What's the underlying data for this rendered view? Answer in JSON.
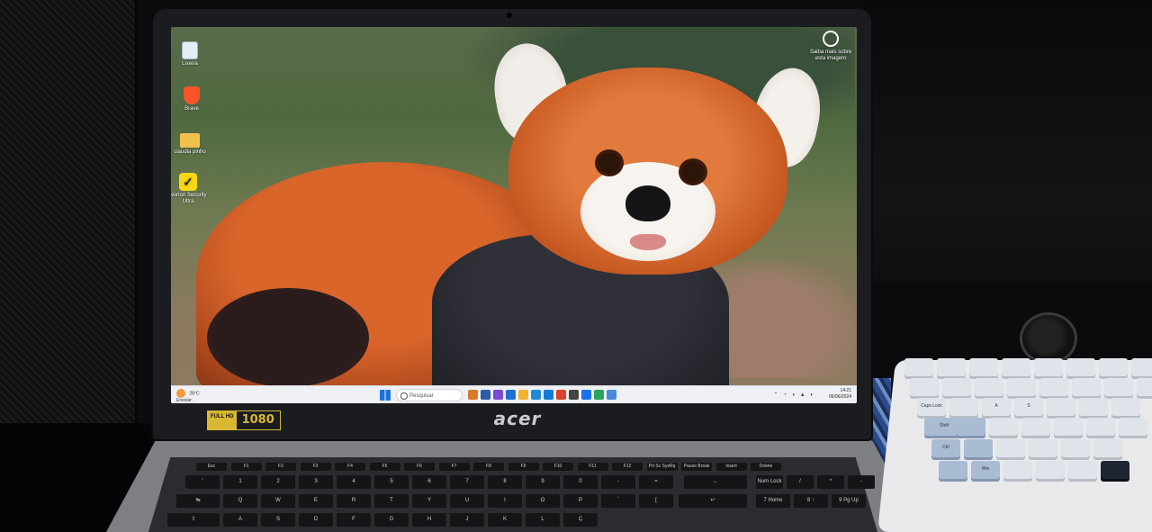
{
  "screen": {
    "desktop_icons": [
      {
        "label": "Lixeira",
        "icon": "recycle-bin-icon"
      },
      {
        "label": "Brave",
        "icon": "brave-lion-icon"
      },
      {
        "label": "claudia pinho",
        "icon": "folder-icon"
      },
      {
        "label": "Norton Security Ultra",
        "icon": "norton-check-icon"
      }
    ],
    "spotlight": {
      "label": "Saiba mais sobre esta imagem",
      "icon": "camera-spotlight-icon"
    },
    "taskbar": {
      "weather": {
        "temp": "28°C",
        "condition": "Ensolar.",
        "icon": "sun-icon"
      },
      "search_placeholder": "Pesquisar",
      "start_icon": "windows-start-icon",
      "pinned_apps": [
        {
          "name": "app-icon-1",
          "color": "#d97a2a"
        },
        {
          "name": "app-icon-2",
          "color": "#2e5aa8"
        },
        {
          "name": "app-icon-3",
          "color": "#7a4ad0"
        },
        {
          "name": "app-icon-4",
          "color": "#1f6fd1"
        },
        {
          "name": "app-icon-5",
          "color": "#f2b233"
        },
        {
          "name": "app-icon-6",
          "color": "#1d8ad8"
        },
        {
          "name": "app-icon-7",
          "color": "#0e7bd6"
        },
        {
          "name": "app-icon-8",
          "color": "#d8432a"
        },
        {
          "name": "app-icon-9",
          "color": "#444444"
        },
        {
          "name": "app-icon-10",
          "color": "#1a73e8"
        },
        {
          "name": "app-icon-11",
          "color": "#2aa55a"
        },
        {
          "name": "app-icon-12",
          "color": "#4a8ad8"
        }
      ],
      "tray_time": "14:21",
      "tray_date": "06/06/2024"
    }
  },
  "bezel": {
    "badge_left": "FULL HD",
    "badge_right": "1080",
    "brand": "acer"
  },
  "keyboard": {
    "function_row": [
      "Esc",
      "F1",
      "F2",
      "F3",
      "F4",
      "F5",
      "F6",
      "F7",
      "F8",
      "F9",
      "F10",
      "F11",
      "F12",
      "Prt Sc SysRq",
      "Pause Break",
      "Insert",
      "Delete"
    ],
    "number_row": [
      "'",
      "1",
      "2",
      "3",
      "4",
      "5",
      "6",
      "7",
      "8",
      "9",
      "0",
      "-",
      "="
    ],
    "qwerty_row": [
      "Q",
      "W",
      "E",
      "R",
      "T",
      "Y",
      "U",
      "I",
      "O",
      "P"
    ],
    "asdf_row": [
      "A",
      "S",
      "D",
      "F",
      "G",
      "H",
      "J",
      "K",
      "L",
      "Ç"
    ],
    "numpad_top": [
      "Num Lock",
      "/",
      "*",
      "-"
    ],
    "numpad_mid": [
      "7 Home",
      "8 ↑",
      "9 Pg Up"
    ]
  },
  "mech_keyboard": {
    "labels": [
      "Caps Lock",
      "Shift",
      "Ctrl",
      "Win",
      "A",
      "S"
    ]
  }
}
